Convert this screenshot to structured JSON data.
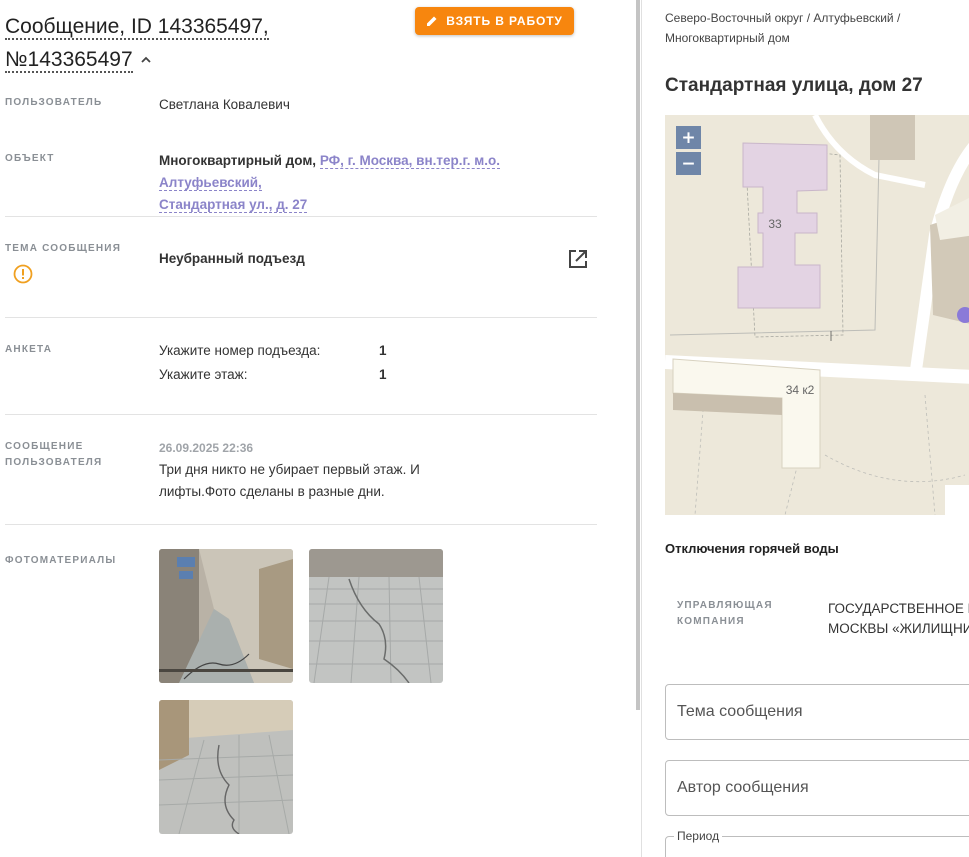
{
  "message": {
    "title_line1": "Сообщение, ID 143365497,",
    "title_line2": "№143365497",
    "take_button": "ВЗЯТЬ В РАБОТУ"
  },
  "details": {
    "user_label": "ПОЛЬЗОВАТЕЛЬ",
    "user_value": "Светлана Ковалевич",
    "object_label": "ОБЪЕКТ",
    "object_type": "Многоквартирный дом,",
    "object_address_1": "РФ, г. Москва, вн.тер.г. м.о. Алтуфьевский,",
    "object_address_2": "Стандартная ул., д. 27",
    "topic_label": "ТЕМА СООБЩЕНИЯ",
    "topic_value": "Неубранный подъезд",
    "form_label": "АНКЕТА",
    "form_rows": [
      {
        "question": "Укажите номер подъезда:",
        "answer": "1"
      },
      {
        "question": "Укажите этаж:",
        "answer": "1"
      }
    ],
    "msg_label_1": "СООБЩЕНИЕ",
    "msg_label_2": "ПОЛЬЗОВАТЕЛЯ",
    "msg_date": "26.09.2025 22:36",
    "msg_text_1": "Три дня никто не убирает первый этаж. И",
    "msg_text_2": "лифты.Фото сделаны в разные дни.",
    "photos_label": "ФОТОМАТЕРИАЛЫ"
  },
  "sidebar": {
    "breadcrumb_1": "Северо-Восточный округ / Алтуфьевский /",
    "breadcrumb_2": "Многоквартирный дом",
    "address": "Стандартная улица, дом 27",
    "map": {
      "zoom_in": "+",
      "zoom_out": "−",
      "building_1": "33",
      "building_2": "34 к2"
    },
    "hot_water": "Отключения горячей воды",
    "company_label_1": "УПРАВЛЯЮЩАЯ",
    "company_label_2": "КОМПАНИЯ",
    "company_value_1": "ГОСУДАРСТВЕННОЕ Б",
    "company_value_2": "МОСКВЫ «ЖИЛИЩНИ",
    "topic_placeholder": "Тема сообщения",
    "author_placeholder": "Автор сообщения",
    "period_label": "Период"
  },
  "colors": {
    "accent_orange": "#f7860e",
    "link_purple": "#8b84c9",
    "warning_orange": "#f0a020"
  }
}
